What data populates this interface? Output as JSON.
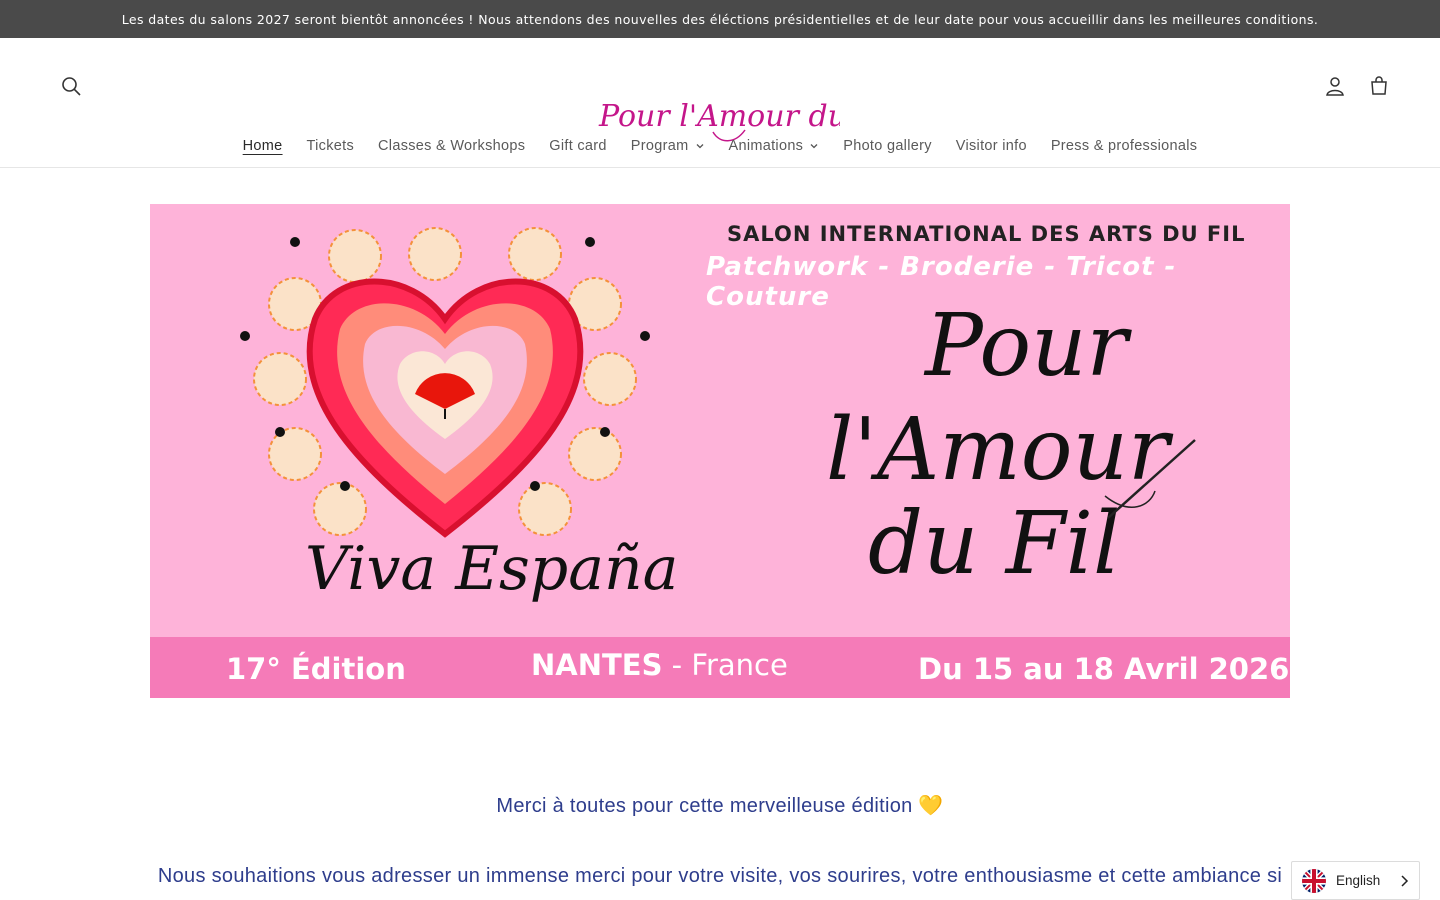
{
  "announcement": {
    "text": "Les dates du salons 2027 seront bientôt annoncées ! Nous attendons des nouvelles des éléctions présidentielles et de leur date pour vous accueillir dans les meilleures conditions."
  },
  "header": {
    "logo_text": "Pour l'Amour du Fil",
    "icons": {
      "search": "search-icon",
      "account": "account-icon",
      "cart": "cart-icon"
    }
  },
  "nav": {
    "items": [
      {
        "label": "Home",
        "active": true,
        "dropdown": false
      },
      {
        "label": "Tickets",
        "active": false,
        "dropdown": false
      },
      {
        "label": "Classes & Workshops",
        "active": false,
        "dropdown": false
      },
      {
        "label": "Gift card",
        "active": false,
        "dropdown": false
      },
      {
        "label": "Program",
        "active": false,
        "dropdown": true
      },
      {
        "label": "Animations",
        "active": false,
        "dropdown": true
      },
      {
        "label": "Photo gallery",
        "active": false,
        "dropdown": false
      },
      {
        "label": "Visitor info",
        "active": false,
        "dropdown": false
      },
      {
        "label": "Press & professionals",
        "active": false,
        "dropdown": false
      }
    ]
  },
  "banner": {
    "title": "SALON INTERNATIONAL DES ARTS DU FIL",
    "subtitle": "Patchwork - Broderie - Tricot - Couture",
    "script_pour": "Pour",
    "script_amour": "l'Amour",
    "script_dufil": "du Fil",
    "theme": "Viva España",
    "edition": "17° Édition",
    "city_bold": "NANTES",
    "city_rest": " - France",
    "dates": "Du 15 au 18 Avril 2026",
    "colors": {
      "background": "#feb3d9",
      "strip": "#f57bb8"
    }
  },
  "content": {
    "thanks": "Merci à toutes pour cette merveilleuse édition 💛",
    "paragraph": "Nous souhaitions vous adresser un immense merci pour votre visite, vos sourires, votre enthousiasme et cette ambiance si"
  },
  "language": {
    "label": "English",
    "flag": "uk-flag-icon"
  }
}
